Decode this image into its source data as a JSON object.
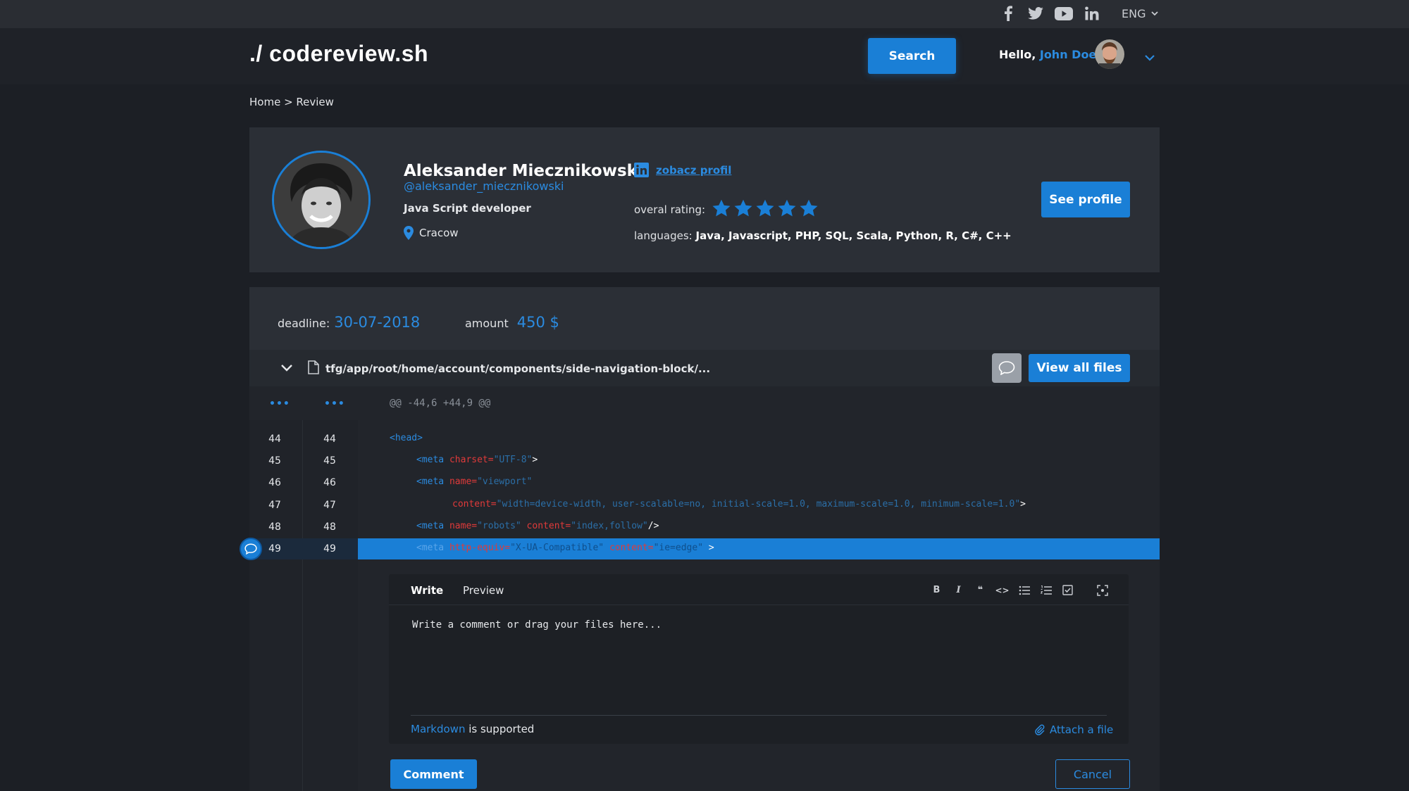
{
  "topbar": {
    "social_icons": [
      "facebook-icon",
      "twitter-icon",
      "youtube-icon",
      "linkedin-icon"
    ],
    "language": "ENG"
  },
  "header": {
    "logo": "./ codereview.sh",
    "search_label": "Search",
    "greeting": "Hello,",
    "user_name": "John Doe"
  },
  "breadcrumb": "Home > Review",
  "profile": {
    "name": "Aleksander Miecznikowski",
    "handle": "@aleksander_miecznikowski",
    "role": "Java Script developer",
    "location": "Cracow",
    "link_label": "zobacz profil",
    "rating_label": "overal rating:",
    "rating": 5,
    "rating_max": 5,
    "languages_label": "languages:",
    "languages": "Java, Javascript, PHP, SQL, Scala, Python, R, C#, C++",
    "see_profile_label": "See profile"
  },
  "review": {
    "deadline_label": "deadline:",
    "deadline": "30-07-2018",
    "amount_label": "amount",
    "amount": "450 $",
    "file_path": "tfg/app/root/home/account/components/side-navigation-block/...",
    "view_all_label": "View all files",
    "hunk_dots_left": "•••",
    "hunk_dots_right": "•••",
    "hunk_header": "@@ -44,6 +44,9 @@"
  },
  "diff_lines": [
    {
      "old": "44",
      "new": "44"
    },
    {
      "old": "45",
      "new": "45"
    },
    {
      "old": "46",
      "new": "46"
    },
    {
      "old": "47",
      "new": "47"
    },
    {
      "old": "48",
      "new": "48"
    },
    {
      "old": "49",
      "new": "49"
    }
  ],
  "code": {
    "l44_tag": "<head>",
    "l45_tag": "<meta",
    "l45_attr": " charset=",
    "l45_str": "\"UTF-8\"",
    "l45_end": ">",
    "l46_tag": "<meta",
    "l46_attr": " name=",
    "l46_str": "\"viewport\"",
    "l47_attr": "content=",
    "l47_str": "\"width=device-width, user-scalable=no, initial-scale=1.0, maximum-scale=1.0, minimum-scale=1.0\"",
    "l47_end": ">",
    "l48_tag": "<meta",
    "l48_attr1": " name=",
    "l48_str1": "\"robots\"",
    "l48_attr2": " content=",
    "l48_str2": "\"index,follow\"",
    "l48_end": "/>",
    "l49_tag": "<meta",
    "l49_attr1": " http-equiv=",
    "l49_str1": "\"X-UA-Compatible\"",
    "l49_attr2": " content=",
    "l49_str2": "\"ie=edge\"",
    "l49_end": " >"
  },
  "editor": {
    "tab_write": "Write",
    "tab_preview": "Preview",
    "toolbar": [
      "bold-icon",
      "italic-icon",
      "quote-icon",
      "code-icon",
      "bullet-list-icon",
      "numbered-list-icon",
      "task-list-icon",
      "fullscreen-icon"
    ],
    "toolbar_glyphs": {
      "bold": "B",
      "italic": "I",
      "quote": "❝",
      "code": "<>"
    },
    "placeholder": "Write a comment or drag your files here...",
    "markdown_link": "Markdown",
    "markdown_suffix": " is supported",
    "attach_label": "Attach a file",
    "submit_label": "Comment",
    "cancel_label": "Cancel"
  },
  "colors": {
    "accent": "#1a7fd6",
    "link": "#2b8be0",
    "background": "#1c1f25",
    "card": "#2b2f36",
    "attr": "#e03a3a"
  }
}
